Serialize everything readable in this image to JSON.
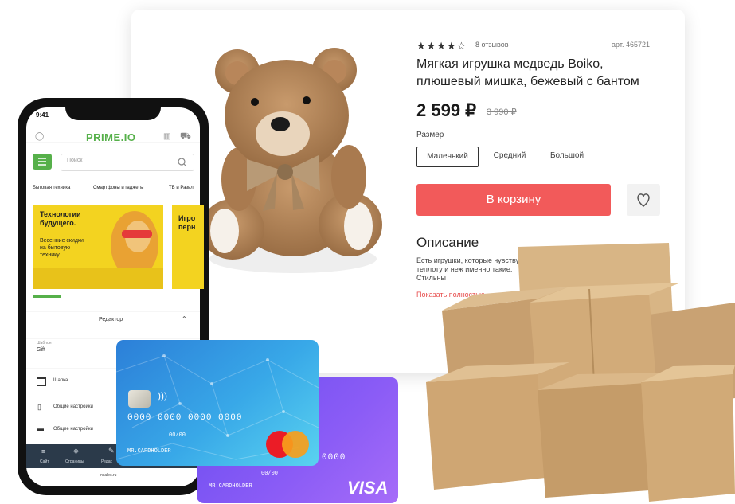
{
  "product": {
    "stars": "★★★★☆",
    "reviews": "8 отзывов",
    "sku": "арт. 465721",
    "title_line1": "Мягкая игрушка медведь Boiko,",
    "title_line2": "плюшевый мишка, бежевый с бантом",
    "price": "2 599 ₽",
    "old_price": "3 990 ₽",
    "size_label": "Размер",
    "sizes": [
      "Маленький",
      "Средний",
      "Большой"
    ],
    "cart_button": "В корзину",
    "description_heading": "Описание",
    "description_text": "Есть игрушки, которые чувству теплоту и неж именно такие. Стильны",
    "show_more": "Показать полностью"
  },
  "phone": {
    "time": "9:41",
    "logo": "PRIME.IO",
    "search_placeholder": "Поиск",
    "categories": [
      "Бытовая техника",
      "Смартфоны и гаджеты",
      "ТВ и Развл"
    ],
    "banner1_title": "Технологии будущего.",
    "banner1_sub": "Весенние скидки на бытовую технику",
    "banner2_title": "Игро перн",
    "editor_label": "Редактор",
    "field_label": "Шаблон",
    "field_value": "Gift",
    "rows": [
      "Шапка",
      "Общие настройки",
      "Общие настройки"
    ],
    "tabs": [
      "Сайт",
      "Страницы",
      "Редак"
    ],
    "url": "insales.ru"
  },
  "card_blue": {
    "number": "0000 0000 0000 0000",
    "expiry": "00/00",
    "holder": "MR.CARDHOLDER"
  },
  "card_visa": {
    "number_tail": "0000",
    "expiry": "00/00",
    "holder": "MR.CARDHOLDER",
    "brand": "VISA"
  },
  "colors": {
    "cart_button": "#f25a5a",
    "brand_green": "#56b04a",
    "visa_card": "#7b55f4",
    "blue_card": "#38a8e8"
  }
}
